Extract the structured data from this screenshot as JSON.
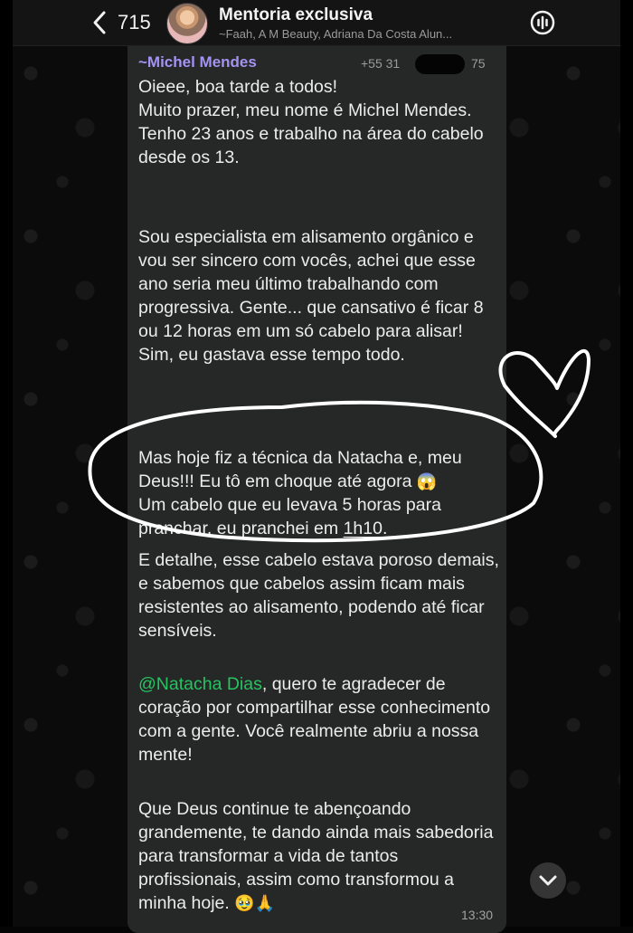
{
  "header": {
    "back_count": "715",
    "title": "Mentoria exclusiva",
    "subtitle": "~Faah, A M Beauty, Adriana Da Costa Alun..."
  },
  "message": {
    "sender": "~Michel Mendes",
    "phone_prefix": "+55 31",
    "phone_suffix": "75",
    "time": "13:30",
    "paragraphs": {
      "p1": "Oieee, boa tarde a todos!\nMuito prazer, meu nome é Michel Mendes.\nTenho 23 anos e trabalho na área do cabelo desde os 13.",
      "p2": "Sou especialista em alisamento orgânico e vou ser sincero com vocês, achei que esse ano seria meu último trabalhando com progressiva. Gente... que cansativo é ficar 8 ou 12 horas em um só cabelo para alisar! Sim, eu gastava esse tempo todo.",
      "p3_part1": "Mas hoje fiz a técnica da Natacha e, meu Deus!!! Eu tô em choque até agora ",
      "p3_emoji": "😱",
      "p3_part2": "\nUm cabelo que eu levava 5 horas para pranchar, eu pranchei em ",
      "p3_time": "1h10",
      "p3_end": ".",
      "p4": "E detalhe, esse cabelo estava poroso demais, e sabemos que cabelos assim ficam mais resistentes ao alisamento, podendo até ficar sensíveis.",
      "p5_mention": "@Natacha Dias",
      "p5_rest": ", quero te agradecer de coração por compartilhar esse conhecimento com a gente. Você realmente abriu a nossa mente!",
      "p6_text": "Que Deus continue te abençoando grandemente, te dando ainda mais sabedoria para transformar a vida de tantos profissionais, assim como transformou a minha hoje. ",
      "p6_emojis": "🥹🙏"
    }
  },
  "colors": {
    "sender": "#a493f2",
    "mention": "#25c461",
    "bubble": "#262727",
    "annotation": "#ffffff"
  },
  "icons": {
    "back": "chevron-left-icon",
    "call": "voice-call-icon",
    "scroll": "chevron-down-icon"
  }
}
